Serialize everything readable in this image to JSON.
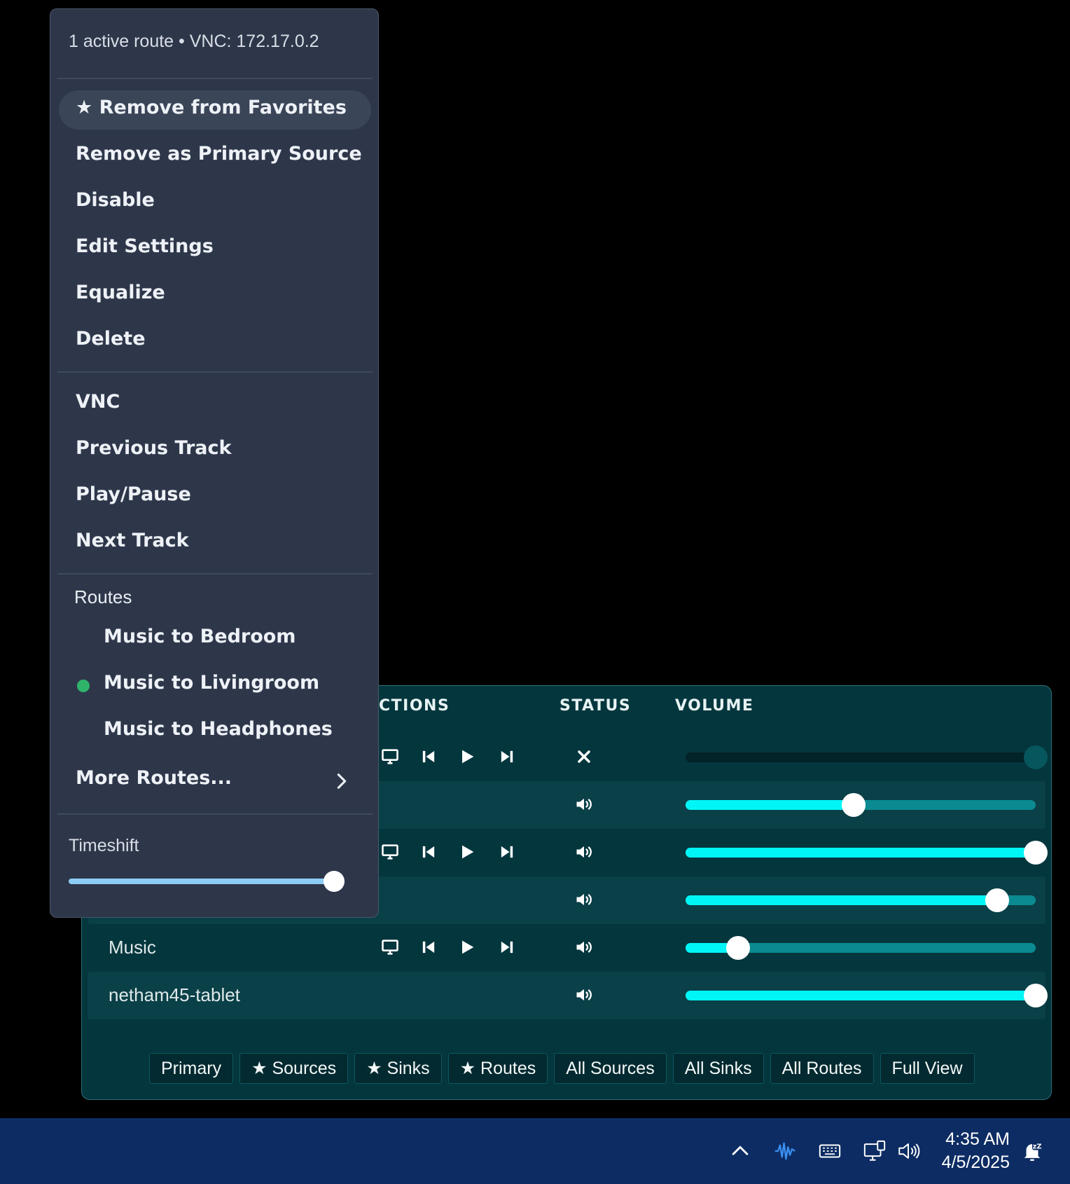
{
  "panel": {
    "headers": {
      "actions": "CTIONS",
      "status": "STATUS",
      "volume": "VOLUME"
    },
    "rows": [
      {
        "name": "",
        "has_controls": true,
        "status": "muted",
        "volume": 1.0
      },
      {
        "name": "",
        "has_controls": false,
        "status": "on",
        "volume": 0.48
      },
      {
        "name": "",
        "has_controls": true,
        "status": "on",
        "volume": 1.0
      },
      {
        "name": "",
        "has_controls": false,
        "status": "on",
        "volume": 0.89
      },
      {
        "name": "Music",
        "has_controls": true,
        "status": "on",
        "volume": 0.15
      },
      {
        "name": "netham45-tablet",
        "has_controls": false,
        "status": "on",
        "volume": 1.0
      }
    ],
    "filters": [
      "Primary",
      "★ Sources",
      "★ Sinks",
      "★ Routes",
      "All Sources",
      "All Sinks",
      "All Routes",
      "Full View"
    ]
  },
  "menu": {
    "header": "1 active route • VNC: 172.17.0.2",
    "items": [
      "★ Remove from Favorites",
      "Remove as Primary Source",
      "Disable",
      "Edit Settings",
      "Equalize",
      "Delete"
    ],
    "media_items": [
      "VNC",
      "Previous Track",
      "Play/Pause",
      "Next Track"
    ],
    "routes_label": "Routes",
    "routes": [
      {
        "label": "Music to Bedroom",
        "active": false
      },
      {
        "label": "Music to Livingroom",
        "active": true
      },
      {
        "label": "Music to Headphones",
        "active": false
      }
    ],
    "more_routes": "More Routes...",
    "timeshift_label": "Timeshift",
    "timeshift_value": 1.0
  },
  "taskbar": {
    "time": "4:35 AM",
    "date": "4/5/2025",
    "tray_icons": [
      "chevron-up-icon",
      "audio-wave-icon",
      "keyboard-icon",
      "network-icon",
      "speaker-icon",
      "notification-icon"
    ]
  },
  "colors": {
    "accent_cyan": "#00f6f6",
    "panel_bg": "#04363d",
    "menu_bg": "#2e374a",
    "active_dot": "#2fb36b",
    "taskbar_bg": "#0c2c63"
  }
}
